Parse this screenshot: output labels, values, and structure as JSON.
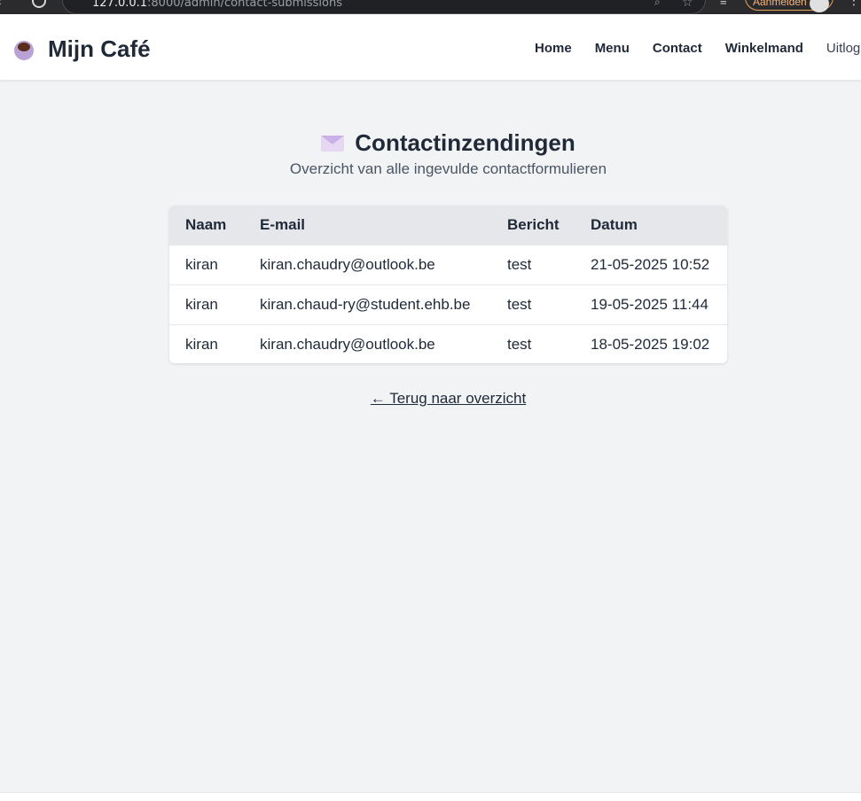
{
  "browser": {
    "url_host": "127.0.0.1",
    "url_rest": ":8000/admin/contact-submissions",
    "signin_label": "Aanmelden"
  },
  "navbar": {
    "brand": "Mijn Café",
    "links": [
      {
        "label": "Home"
      },
      {
        "label": "Menu"
      },
      {
        "label": "Contact"
      },
      {
        "label": "Winkelmand"
      },
      {
        "label": "Uitlog"
      }
    ]
  },
  "page": {
    "title": "Contactinzendingen",
    "subtitle": "Overzicht van alle ingevulde contactformulieren",
    "back_link": "← Terug naar overzicht"
  },
  "table": {
    "headers": [
      "Naam",
      "E-mail",
      "Bericht",
      "Datum"
    ],
    "rows": [
      [
        "kiran",
        "kiran.chaudry@outlook.be",
        "test",
        "21-05-2025 10:52"
      ],
      [
        "kiran",
        "kiran.chaud-ry@student.ehb.be",
        "test",
        "19-05-2025 11:44"
      ],
      [
        "kiran",
        "kiran.chaudry@outlook.be",
        "test",
        "18-05-2025 19:02"
      ]
    ]
  },
  "icons": {
    "brand": "coffee-cup-icon",
    "title": "envelope-icon"
  }
}
